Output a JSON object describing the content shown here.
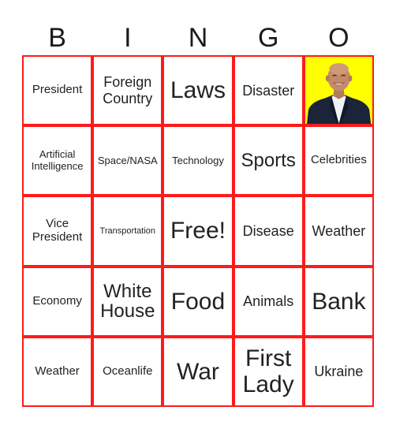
{
  "card": {
    "header_letters": [
      "B",
      "I",
      "N",
      "G",
      "O"
    ],
    "border_color": "#ff1a1a",
    "photo_background": "#ffff00",
    "cells": [
      {
        "text": "President",
        "size": "s15"
      },
      {
        "text": "Foreign Country",
        "size": "s18"
      },
      {
        "text": "Laws",
        "size": "s30"
      },
      {
        "text": "Disaster",
        "size": "s18"
      },
      {
        "text": "",
        "size": "photo",
        "image": "person-photo"
      },
      {
        "text": "Artificial Intelligence",
        "size": "s13"
      },
      {
        "text": "Space/NASA",
        "size": "s13"
      },
      {
        "text": "Technology",
        "size": "s13"
      },
      {
        "text": "Sports",
        "size": "s24"
      },
      {
        "text": "Celebrities",
        "size": "s15"
      },
      {
        "text": "Vice President",
        "size": "s15"
      },
      {
        "text": "Transportation",
        "size": "s11"
      },
      {
        "text": "Free!",
        "size": "s30"
      },
      {
        "text": "Disease",
        "size": "s18"
      },
      {
        "text": "Weather",
        "size": "s18"
      },
      {
        "text": "Economy",
        "size": "s15"
      },
      {
        "text": "White House",
        "size": "s24"
      },
      {
        "text": "Food",
        "size": "s30"
      },
      {
        "text": "Animals",
        "size": "s18"
      },
      {
        "text": "Bank",
        "size": "s30"
      },
      {
        "text": "Weather",
        "size": "s15"
      },
      {
        "text": "Oceanlife",
        "size": "s15"
      },
      {
        "text": "War",
        "size": "s30"
      },
      {
        "text": "First Lady",
        "size": "s30"
      },
      {
        "text": "Ukraine",
        "size": "s18"
      }
    ]
  }
}
